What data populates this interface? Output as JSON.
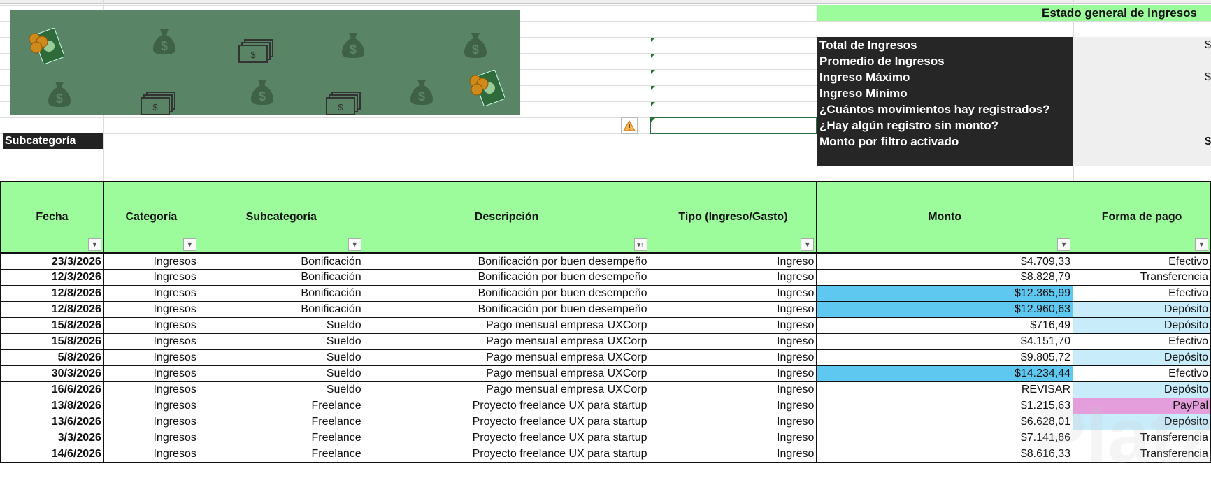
{
  "panel": {
    "title": "Estado general de ingresos",
    "labels": [
      "Total de Ingresos",
      "Promedio de Ingresos",
      "Ingreso Máximo",
      "Ingreso Mínimo",
      "¿Cuántos movimientos hay registrados?",
      "¿Hay algún registro sin monto?",
      "Monto por filtro activado"
    ],
    "values": [
      "$",
      "",
      "$",
      "",
      "",
      "",
      "$"
    ]
  },
  "filter_label": "Subcategoría",
  "table": {
    "headers": [
      "Fecha",
      "Categoría",
      "Subcategoría",
      "Descripción",
      "Tipo (Ingreso/Gasto)",
      "Monto",
      "Forma de pago"
    ],
    "rows": [
      [
        "23/3/2026",
        "Ingresos",
        "Bonificación",
        "Bonificación por buen desempeño",
        "Ingreso",
        "$4.709,33",
        "Efectivo"
      ],
      [
        "12/3/2026",
        "Ingresos",
        "Bonificación",
        "Bonificación por buen desempeño",
        "Ingreso",
        "$8.828,79",
        "Transferencia"
      ],
      [
        "12/8/2026",
        "Ingresos",
        "Bonificación",
        "Bonificación por buen desempeño",
        "Ingreso",
        "$12.365,99",
        "Efectivo"
      ],
      [
        "12/8/2026",
        "Ingresos",
        "Bonificación",
        "Bonificación por buen desempeño",
        "Ingreso",
        "$12.960,63",
        "Depósito"
      ],
      [
        "15/8/2026",
        "Ingresos",
        "Sueldo",
        "Pago mensual empresa UXCorp",
        "Ingreso",
        "$716,49",
        "Depósito"
      ],
      [
        "15/8/2026",
        "Ingresos",
        "Sueldo",
        "Pago mensual empresa UXCorp",
        "Ingreso",
        "$4.151,70",
        "Efectivo"
      ],
      [
        "5/8/2026",
        "Ingresos",
        "Sueldo",
        "Pago mensual empresa UXCorp",
        "Ingreso",
        "$9.805,72",
        "Depósito"
      ],
      [
        "30/3/2026",
        "Ingresos",
        "Sueldo",
        "Pago mensual empresa UXCorp",
        "Ingreso",
        "$14.234,44",
        "Efectivo"
      ],
      [
        "16/6/2026",
        "Ingresos",
        "Sueldo",
        "Pago mensual empresa UXCorp",
        "Ingreso",
        "REVISAR",
        "Depósito"
      ],
      [
        "13/8/2026",
        "Ingresos",
        "Freelance",
        "Proyecto freelance UX para startup",
        "Ingreso",
        "$1.215,63",
        "PayPal"
      ],
      [
        "13/6/2026",
        "Ingresos",
        "Freelance",
        "Proyecto freelance UX para startup",
        "Ingreso",
        "$6.628,01",
        "Depósito"
      ],
      [
        "3/3/2026",
        "Ingresos",
        "Freelance",
        "Proyecto freelance UX para startup",
        "Ingreso",
        "$7.141,86",
        "Transferencia"
      ],
      [
        "14/6/2026",
        "Ingresos",
        "Freelance",
        "Proyecto freelance UX para startup",
        "Ingreso",
        "$8.616,33",
        "Transferencia"
      ]
    ]
  },
  "highlights": {
    "high_amount": "#5ec8f0",
    "deposito": "#c9ecfa",
    "paypal": "#e49edc",
    "header": "#9cfc9c"
  },
  "watermark": "Platzi"
}
